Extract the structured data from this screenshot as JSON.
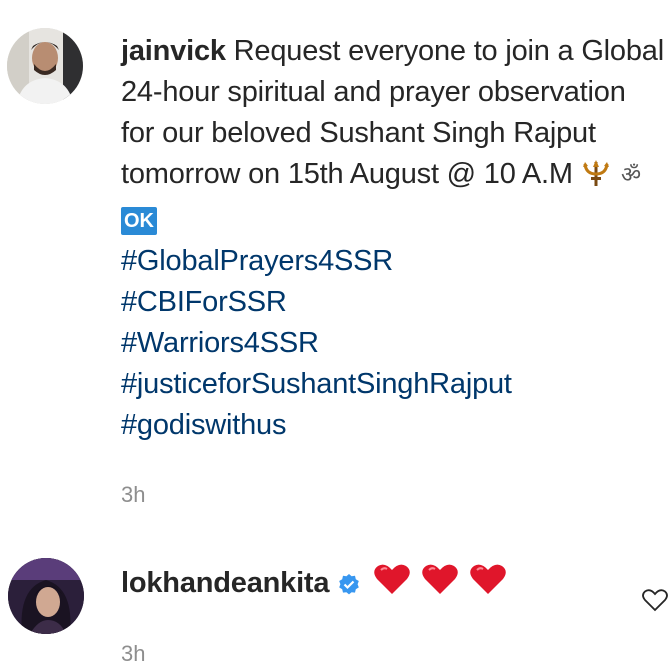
{
  "comments": [
    {
      "username": "jainvick",
      "text_before_emoji": "Request everyone to join a Global 24-hour spiritual and prayer observation for our beloved Sushant Singh Rajput tomorrow on 15th August @ 10 A.M",
      "ok_badge": "OK",
      "hashtags": [
        "#GlobalPrayers4SSR",
        "#CBIForSSR",
        "#Warriors4SSR",
        "#justiceforSushantSinghRajput",
        "#godiswithus"
      ],
      "timestamp": "3h",
      "icons": [
        "trishul-icon",
        "om-icon",
        "ok-button-icon"
      ]
    },
    {
      "username": "lokhandeankita",
      "verified": true,
      "reaction_icons": [
        "heart-icon",
        "heart-icon",
        "heart-icon"
      ],
      "timestamp": "3h"
    }
  ],
  "colors": {
    "text": "#262626",
    "hashtag": "#00376b",
    "muted": "#8e8e8e",
    "verified": "#3897f0",
    "heart": "#e0162b"
  }
}
